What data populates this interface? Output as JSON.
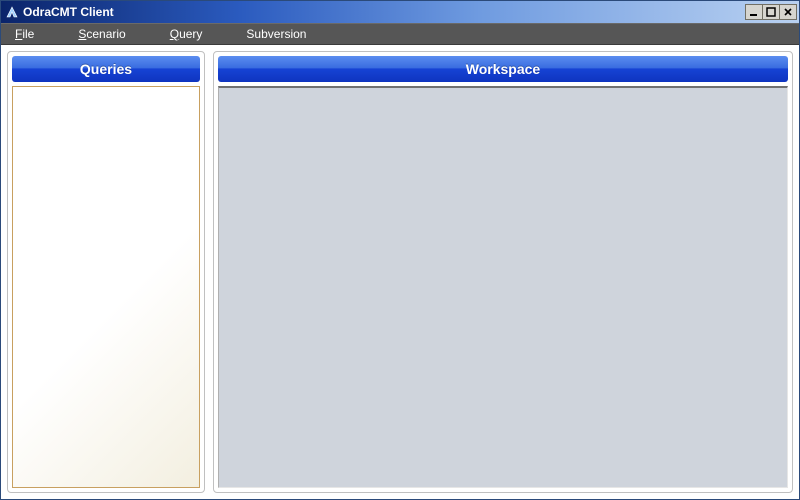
{
  "window": {
    "title": "OdraCMT Client"
  },
  "menu": {
    "file": "File",
    "scenario": "Scenario",
    "query": "Query",
    "subversion": "Subversion"
  },
  "panels": {
    "queries_header": "Queries",
    "workspace_header": "Workspace"
  }
}
